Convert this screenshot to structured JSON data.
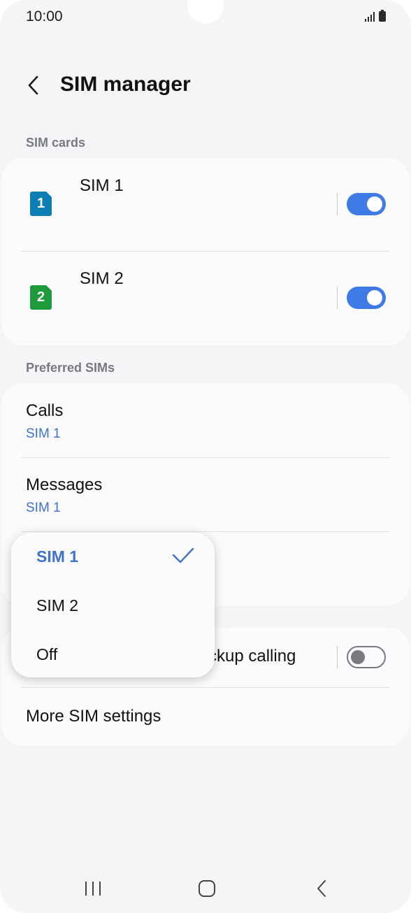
{
  "status_bar": {
    "time": "10:00",
    "icons": [
      "signal-icon",
      "battery-icon"
    ]
  },
  "header": {
    "title": "SIM manager",
    "back_icon": "chevron-left-icon"
  },
  "sim_cards": {
    "label": "SIM cards",
    "items": [
      {
        "name": "SIM 1",
        "badge": "1",
        "badge_color": "#0b7fb3",
        "enabled": true
      },
      {
        "name": "SIM 2",
        "badge": "2",
        "badge_color": "#1e9a3b",
        "enabled": true
      }
    ]
  },
  "preferred": {
    "label": "Preferred SIMs",
    "items": [
      {
        "title": "Calls",
        "value": "SIM 1"
      },
      {
        "title": "Messages",
        "value": "SIM 1"
      }
    ]
  },
  "more_card": {
    "backup_calling_partial": "ckup calling",
    "backup_calling_enabled": false,
    "more_settings": "More SIM settings"
  },
  "popup": {
    "options": [
      "SIM 1",
      "SIM 2",
      "Off"
    ],
    "selected": "SIM 1",
    "check_icon": "check-icon"
  },
  "nav_bar": {
    "icons": [
      "recent-apps-icon",
      "home-icon",
      "back-icon"
    ]
  },
  "colors": {
    "accent": "#3e7be6",
    "link": "#3e73c9",
    "background": "#f5f5f7"
  }
}
